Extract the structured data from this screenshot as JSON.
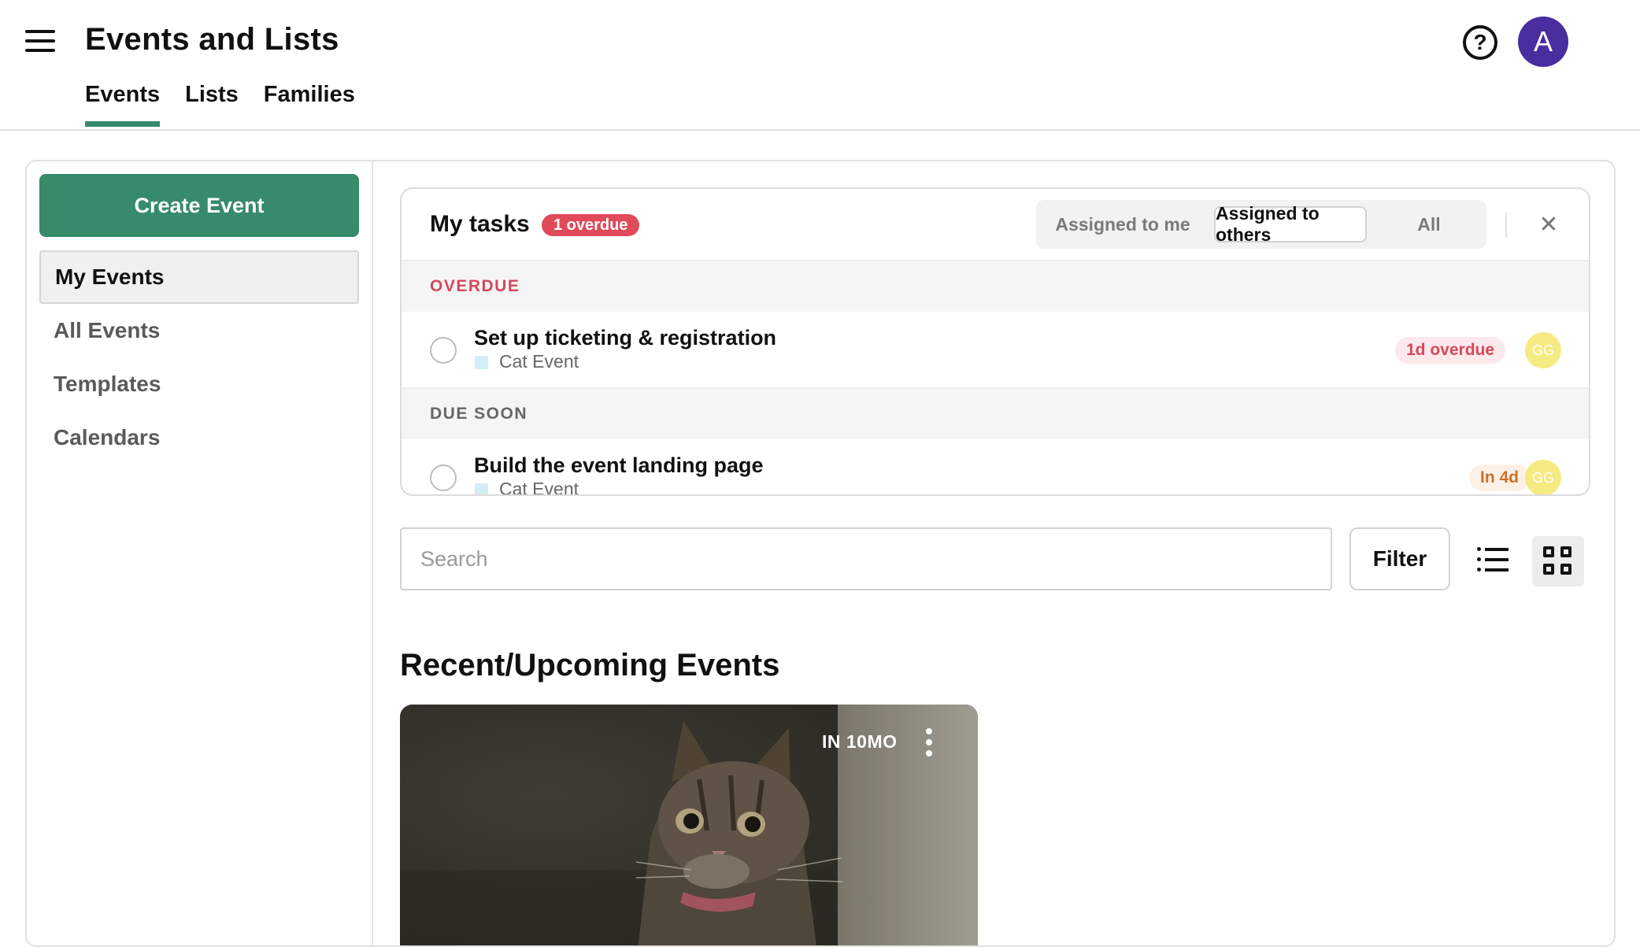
{
  "header": {
    "app_title": "Events and Lists",
    "help_icon_glyph": "?",
    "avatar_letter": "A",
    "avatar_color": "#4a2ea0",
    "tabs": [
      {
        "label": "Events",
        "active": true
      },
      {
        "label": "Lists",
        "active": false
      },
      {
        "label": "Families",
        "active": false
      }
    ]
  },
  "sidebar": {
    "create_label": "Create Event",
    "accent_color": "#378a6a",
    "items": [
      {
        "label": "My Events",
        "active": true
      },
      {
        "label": "All Events",
        "active": false
      },
      {
        "label": "Templates",
        "active": false
      },
      {
        "label": "Calendars",
        "active": false
      }
    ]
  },
  "tasks": {
    "title": "My tasks",
    "overdue_badge": "1 overdue",
    "filters": [
      {
        "label": "Assigned to me",
        "active": false
      },
      {
        "label": "Assigned to others",
        "active": true
      },
      {
        "label": "All",
        "active": false
      }
    ],
    "close_glyph": "✕",
    "sections": [
      {
        "heading": "OVERDUE",
        "tasks": [
          {
            "name": "Set up ticketing & registration",
            "event": "Cat Event",
            "due": "1d overdue",
            "assignee": "GG"
          }
        ]
      },
      {
        "heading": "DUE SOON",
        "tasks": [
          {
            "name": "Build the event landing page",
            "event": "Cat Event",
            "due": "In 4d",
            "assignee": "GG"
          }
        ]
      }
    ]
  },
  "search": {
    "placeholder": "Search",
    "value": ""
  },
  "toolbar": {
    "filter_label": "Filter",
    "view_mode": "grid"
  },
  "recent": {
    "title": "Recent/Upcoming Events",
    "cards": [
      {
        "when": "IN 10MO",
        "image": "cat-photo"
      }
    ]
  },
  "icons": {
    "menu": "menu-icon",
    "help": "help-circle-icon",
    "close": "close-icon",
    "list_view": "list-view-icon",
    "grid_view": "grid-view-icon",
    "more": "more-vertical-icon"
  }
}
